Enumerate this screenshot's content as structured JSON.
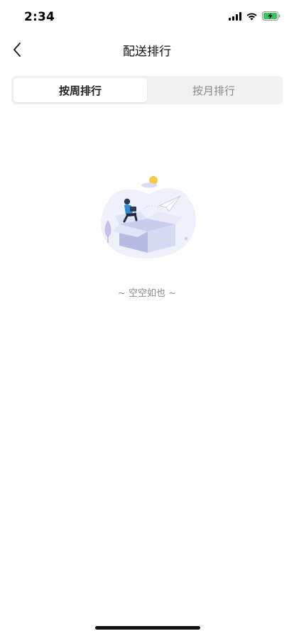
{
  "status_bar": {
    "time": "2:34"
  },
  "nav": {
    "title": "配送排行",
    "back_icon": "chevron-left-icon"
  },
  "tabs": [
    {
      "label": "按周排行",
      "selected": true
    },
    {
      "label": "按月排行",
      "selected": false
    }
  ],
  "empty_state": {
    "text": "~ 空空如也 ~",
    "illustration": "empty-box-illustration"
  },
  "colors": {
    "background": "#ffffff",
    "segment_background": "#f1f1f1",
    "active_text": "#222222",
    "inactive_text": "#888888",
    "empty_text": "#8a8a8a",
    "battery_green": "#35c759"
  }
}
